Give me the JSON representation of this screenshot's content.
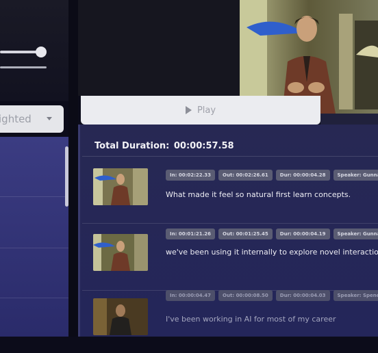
{
  "sidebar": {
    "select_value": "ighted"
  },
  "player": {
    "play_label": "Play"
  },
  "timeline": {
    "total_label": "Total Duration:",
    "total_value": "00:00:57.58"
  },
  "clips": [
    {
      "in": "In: 00:02:22.33",
      "out": "Out: 00:02:26.61",
      "dur": "Dur: 00:00:04.28",
      "speaker": "Speaker: Gunnar",
      "text": "What made it feel so natural first learn concepts."
    },
    {
      "in": "In: 00:01:21.26",
      "out": "Out: 00:01:25.45",
      "dur": "Dur: 00:00:04.19",
      "speaker": "Speaker: Gunnar",
      "text": "we've been using it internally to explore novel interactions."
    },
    {
      "in": "In: 00:00:04.47",
      "out": "Out: 00:00:08.50",
      "dur": "Dur: 00:00:04.03",
      "speaker": "Speaker: Spencer",
      "text": "I've been working in AI for most of my career"
    }
  ]
}
